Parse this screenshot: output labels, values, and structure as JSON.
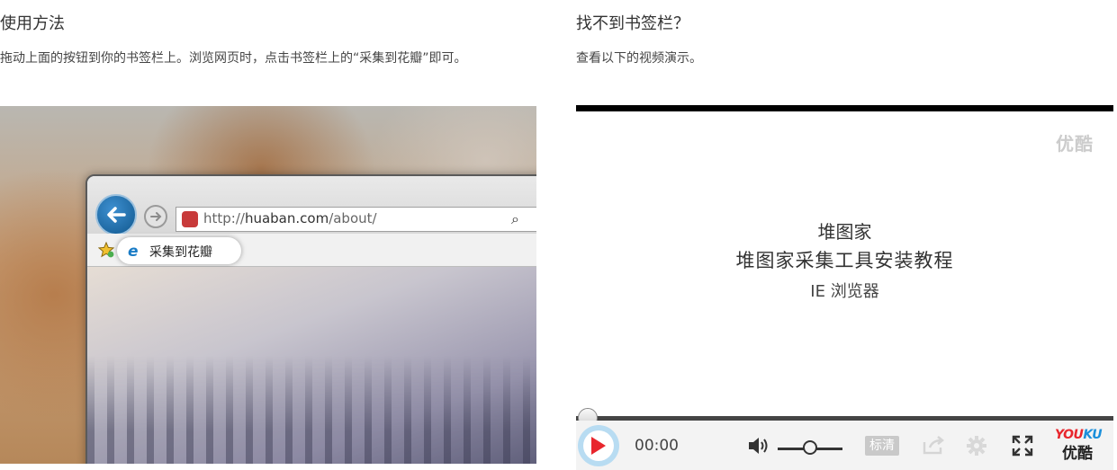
{
  "left": {
    "title": "使用方法",
    "description": "拖动上面的按钮到你的书签栏上。浏览网页时，点击书签栏上的“采集到花瓣”即可。",
    "screenshot": {
      "url_prefix": "http://",
      "url_domain": "huaban.com",
      "url_path": "/about/",
      "bookmark_label": "采集到花瓣"
    }
  },
  "right": {
    "title": "找不到书签栏？",
    "description": "查看以下的视频演示。",
    "video": {
      "watermark": "优酷",
      "line1": "堆图家",
      "line2": "堆图家采集工具安装教程",
      "line3": "IE 浏览器",
      "time": "00:00",
      "progress": 0,
      "volume": 0.5,
      "quality_label": "标清",
      "logo_en_you": "YOU",
      "logo_en_ku": "KU",
      "logo_cn": "优酷"
    }
  },
  "colors": {
    "accent_blue": "#b8dcf2",
    "play_red": "#e8262d",
    "video_border": "#000000"
  }
}
